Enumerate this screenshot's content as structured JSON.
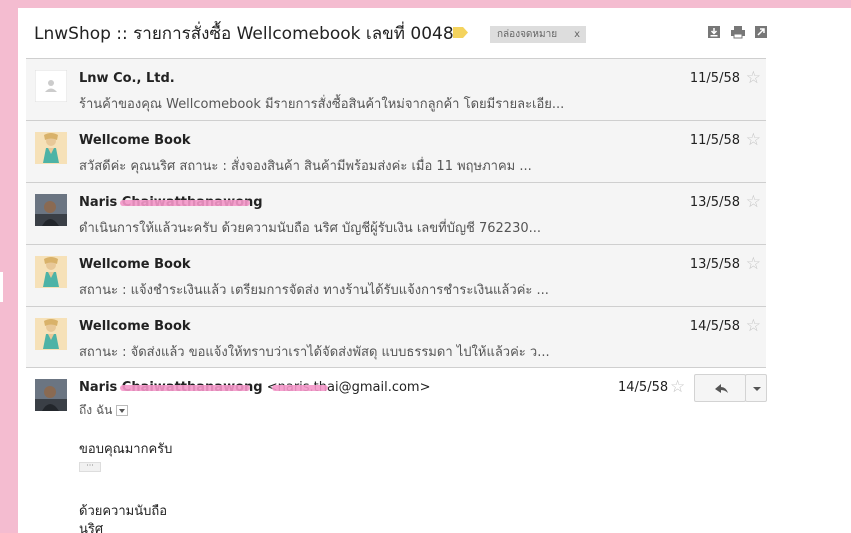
{
  "header": {
    "subject": "LnwShop :: รายการสั่งซื้อ Wellcomebook เลขที่ 0048",
    "label": "กล่องจดหมาย",
    "label_close": "x"
  },
  "messages": [
    {
      "sender": "Lnw Co., Ltd.",
      "snippet": "ร้านค้าของคุณ Wellcomebook มีรายการสั่งซื้อสินค้าใหม่จากลูกค้า โดยมีรายละเอีย...",
      "date": "11/5/58",
      "avatar": "default"
    },
    {
      "sender": "Wellcome Book",
      "snippet": "สวัสดีค่ะ คุณนริศ สถานะ : สั่งจองสินค้า สินค้ามีพร้อมส่งค่ะ เมื่อ 11 พฤษภาคม ...",
      "date": "11/5/58",
      "avatar": "shop"
    },
    {
      "sender": "Naris Chaiwatthanawong",
      "snippet": "ดำเนินการให้แล้วนะครับ ด้วยความนับถือ นริศ บัญชีผู้รับเงิน เลขที่บัญชี 762230...",
      "date": "13/5/58",
      "avatar": "person"
    },
    {
      "sender": "Wellcome Book",
      "snippet": "สถานะ : แจ้งชำระเงินแล้ว เตรียมการจัดส่ง ทางร้านได้รับแจ้งการชำระเงินแล้วค่ะ ...",
      "date": "13/5/58",
      "avatar": "shop"
    },
    {
      "sender": "Wellcome Book",
      "snippet": "สถานะ : จัดส่งแล้ว ขอแจ้งให้ทราบว่าเราได้จัดส่งพัสดุ แบบธรรมดา ไปให้แล้วค่ะ ว...",
      "date": "14/5/58",
      "avatar": "shop"
    }
  ],
  "expanded": {
    "sender_name": "Naris Chaiwatthanawong",
    "sender_email": "<naris.thai@gmail.com>",
    "to_line": "ถึง ฉัน",
    "date": "14/5/58",
    "body": [
      "ขอบคุณมากครับ",
      "ด้วยความนับถือ",
      "นริศ"
    ],
    "quoted_toggle": "···"
  },
  "colors": {
    "background": "#f4bcd0",
    "collapsed_row": "#f5f5f5",
    "redaction": "#f497c9",
    "label_chip": "#dddddd",
    "tag": "#f4d35e"
  }
}
